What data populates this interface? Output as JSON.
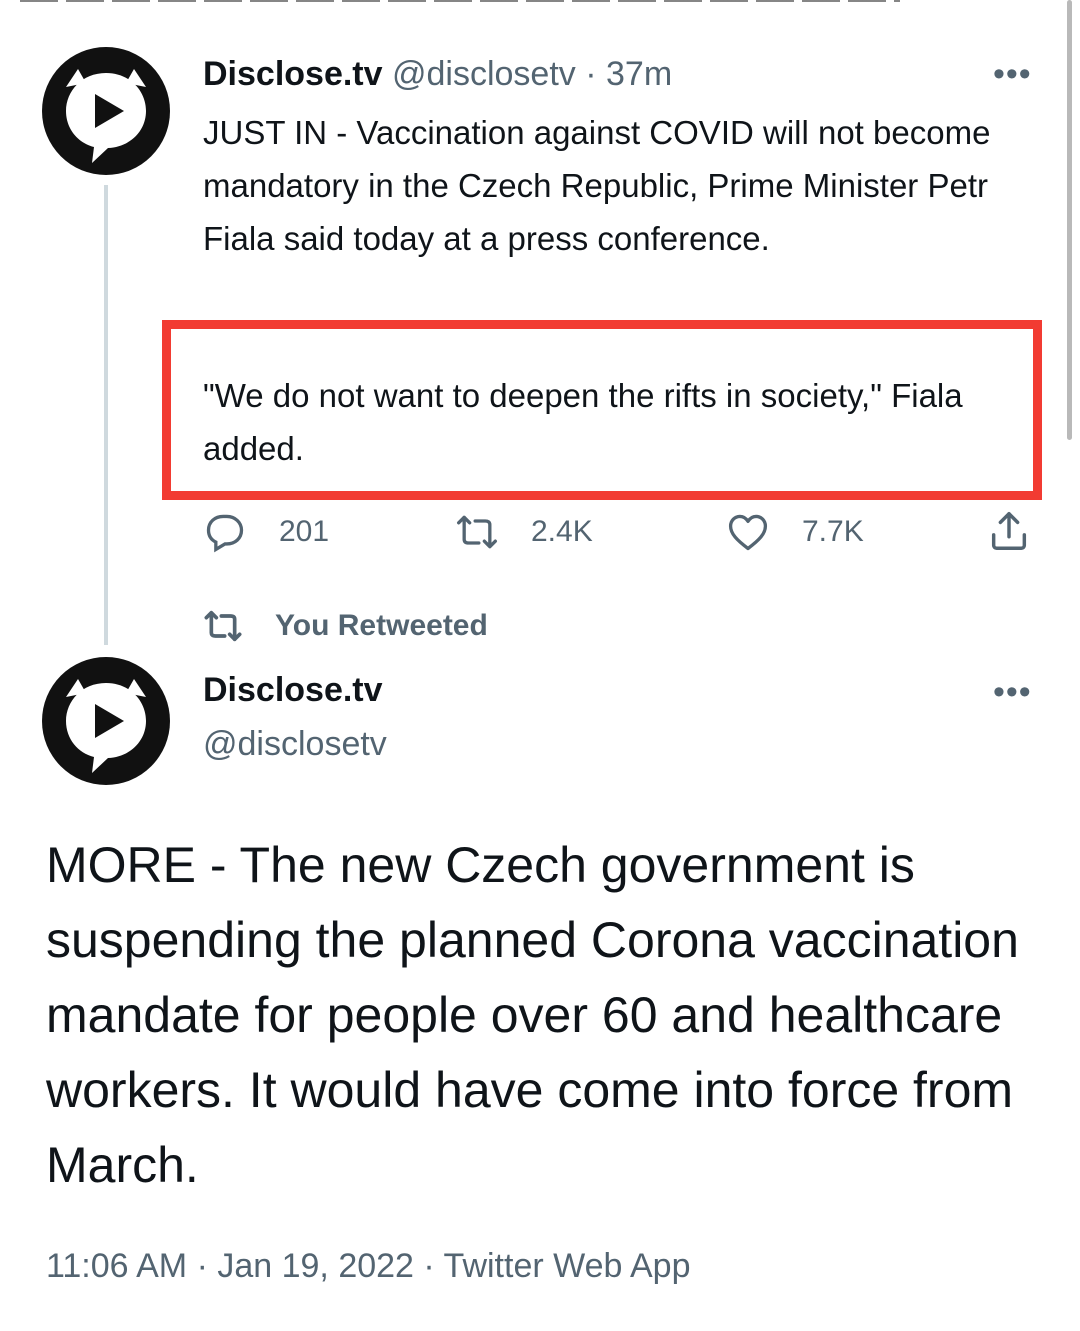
{
  "tweet1": {
    "name": "Disclose.tv",
    "handle": "@disclosetv",
    "separator": "·",
    "time": "37m",
    "more_label": "•••",
    "text": "JUST IN - Vaccination against COVID will not become mandatory in the Czech Republic, Prime Minister Petr Fiala said today at a press conference.",
    "quote": "\"We do not want to deepen the rifts in society,\" Fiala added.",
    "highlight_color": "#f23b32",
    "actions": {
      "reply": {
        "icon": "reply-icon",
        "count": "201"
      },
      "retweet": {
        "icon": "retweet-icon",
        "count": "2.4K"
      },
      "like": {
        "icon": "heart-icon",
        "count": "7.7K"
      },
      "share": {
        "icon": "share-icon"
      }
    }
  },
  "retweet_context": {
    "icon": "retweet-icon",
    "label": "You Retweeted"
  },
  "tweet2": {
    "name": "Disclose.tv",
    "handle": "@disclosetv",
    "more_label": "•••",
    "text": "MORE - The new Czech government is suspending the planned Corona vaccination mandate for people over 60 and healthcare workers. It would have come into force from March.",
    "timestamp": "11:06 AM · Jan 19, 2022 · Twitter Web App"
  },
  "colors": {
    "text": "#0f1419",
    "muted": "#536471",
    "thread_line": "#cfd9de"
  }
}
